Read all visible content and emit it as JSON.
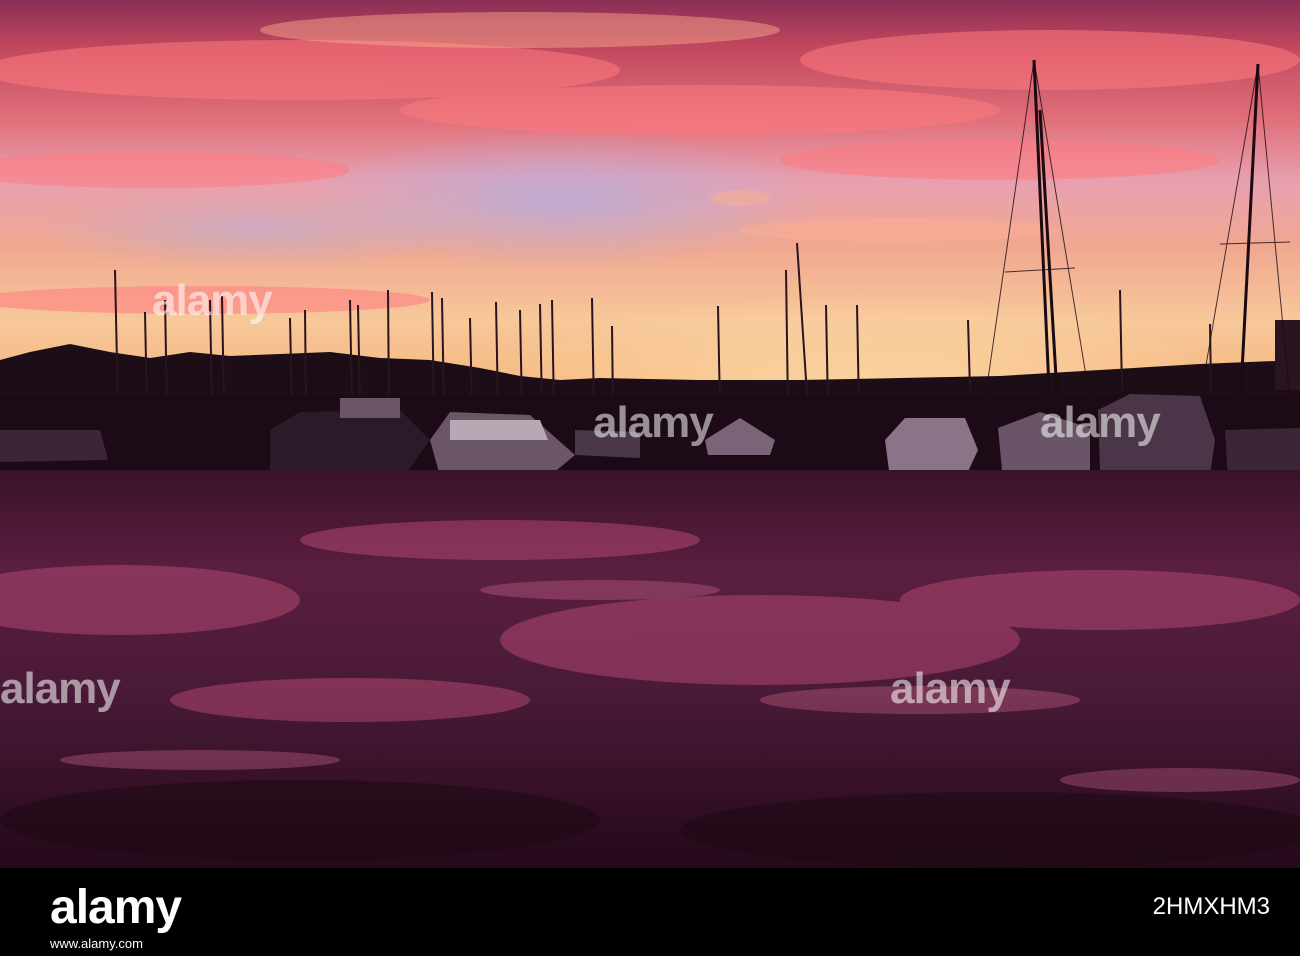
{
  "photo": {
    "watermark_text": "alamy",
    "palette": {
      "sky_top": "#c2485e",
      "sky_mid": "#f0906f",
      "sky_glow": "#f7c89a",
      "sky_blue": "#b4aede",
      "hills": "#1d0d16",
      "water_dark": "#2a0f22",
      "water_reflection": "#c4507a"
    }
  },
  "footer": {
    "logo": "alamy",
    "image_id": "2HMXHM3",
    "url": "www.alamy.com"
  }
}
